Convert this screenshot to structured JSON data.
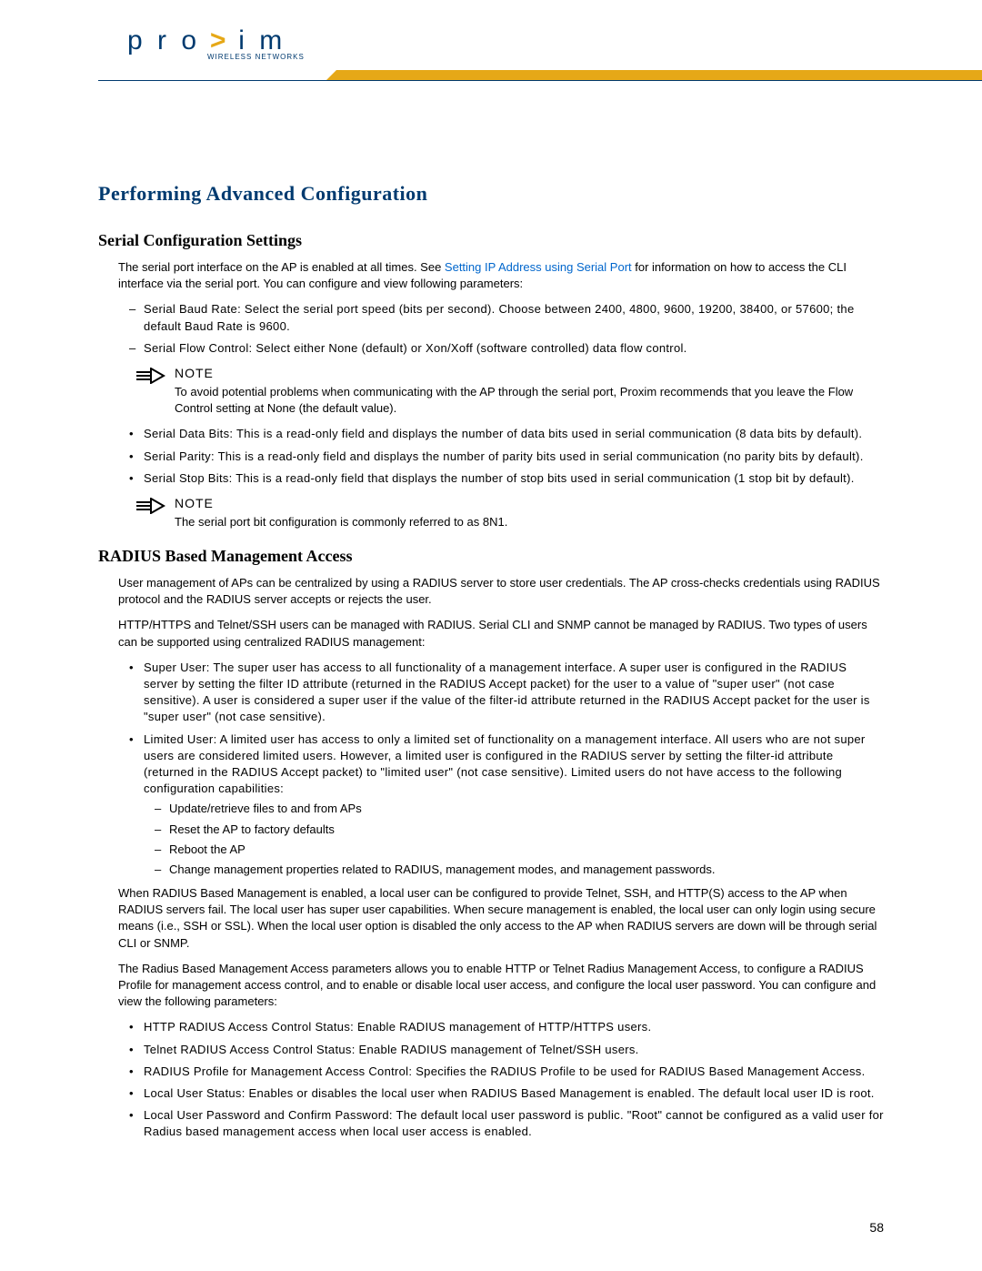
{
  "brand": {
    "name": "proxim",
    "tagline": "WIRELESS NETWORKS"
  },
  "page_title": "Performing Advanced Configuration",
  "page_number": "58",
  "serial": {
    "heading": "Serial Configuration Settings",
    "intro_pre": "The serial port interface on the AP is enabled at all times. See ",
    "intro_link": "Setting IP Address using Serial Port",
    "intro_post": " for information on how to access the CLI interface via the serial port. You can configure and view following parameters:",
    "dash_items": [
      "Serial Baud Rate: Select the serial port speed (bits per second). Choose between 2400, 4800, 9600, 19200, 38400, or 57600; the default Baud Rate is 9600.",
      "Serial Flow Control: Select either None (default) or Xon/Xoff (software controlled) data flow control."
    ],
    "note1_label": "NOTE",
    "note1_text": "To avoid potential problems when communicating with the AP through the serial port, Proxim recommends that you leave the Flow Control setting at None (the default value).",
    "bullet_items": [
      "Serial Data Bits: This is a read-only field and displays the number of data bits used in serial communication (8 data bits by default).",
      "Serial Parity: This is a read-only field and displays the number of parity bits used in serial communication (no parity bits by default).",
      "Serial Stop Bits: This is a read-only field that displays the number of stop bits used in serial communication (1 stop bit by default)."
    ],
    "note2_label": "NOTE",
    "note2_text": "The serial port bit configuration is commonly referred to as 8N1."
  },
  "radius": {
    "heading": "RADIUS Based Management Access",
    "p1": "User management of APs can be centralized by using a RADIUS server to store user credentials. The AP cross-checks credentials using RADIUS protocol and the RADIUS server accepts or rejects the user.",
    "p2": "HTTP/HTTPS and Telnet/SSH users can be managed with RADIUS. Serial CLI and SNMP cannot be managed by RADIUS. Two types of users can be supported using centralized RADIUS management:",
    "user_types": [
      {
        "text": "Super User: The super user has access to all functionality of a management interface. A super user is configured in the RADIUS server by setting the filter ID attribute (returned in the RADIUS Accept packet) for the user to a value of \"super user\" (not case sensitive). A user is considered a super user if the value of the filter-id attribute returned in the RADIUS Accept packet for the user is \"super user\" (not case sensitive)."
      },
      {
        "text": "Limited User: A limited user has access to only a limited set of functionality on a management interface. All users who are not super users are considered limited users. However, a limited user is configured in the RADIUS server by setting the filter-id attribute (returned in the RADIUS Accept packet) to \"limited user\" (not case sensitive). Limited users do not have access to the following configuration capabilities:",
        "subs": [
          "Update/retrieve files to and from APs",
          "Reset the AP to factory defaults",
          "Reboot the AP",
          "Change management properties related to RADIUS, management modes, and management passwords."
        ]
      }
    ],
    "p3": "When RADIUS Based Management is enabled, a local user can be configured to provide Telnet, SSH, and HTTP(S) access to the AP when RADIUS servers fail. The local user has super user capabilities. When secure management is enabled, the local user can only login using secure means (i.e., SSH or SSL). When the local user option is disabled the only access to the AP when RADIUS servers are down will be through serial CLI or SNMP.",
    "p4": "The Radius Based Management Access parameters allows you to enable HTTP or Telnet Radius Management Access, to configure a RADIUS Profile for management access control, and to enable or disable local user access, and configure the local user password. You can configure and view the following parameters:",
    "params": [
      "HTTP RADIUS Access Control Status: Enable RADIUS management of HTTP/HTTPS users.",
      "Telnet RADIUS Access Control Status: Enable RADIUS management of Telnet/SSH users.",
      "RADIUS Profile for Management Access Control: Specifies the RADIUS Profile to be used for RADIUS Based Management Access.",
      "Local User Status: Enables or disables the local user when RADIUS Based Management is enabled. The default local user ID is root.",
      "Local User Password and Confirm Password: The default local user password is public. \"Root\" cannot be configured as a valid user for Radius based management access when local user access is enabled."
    ]
  }
}
